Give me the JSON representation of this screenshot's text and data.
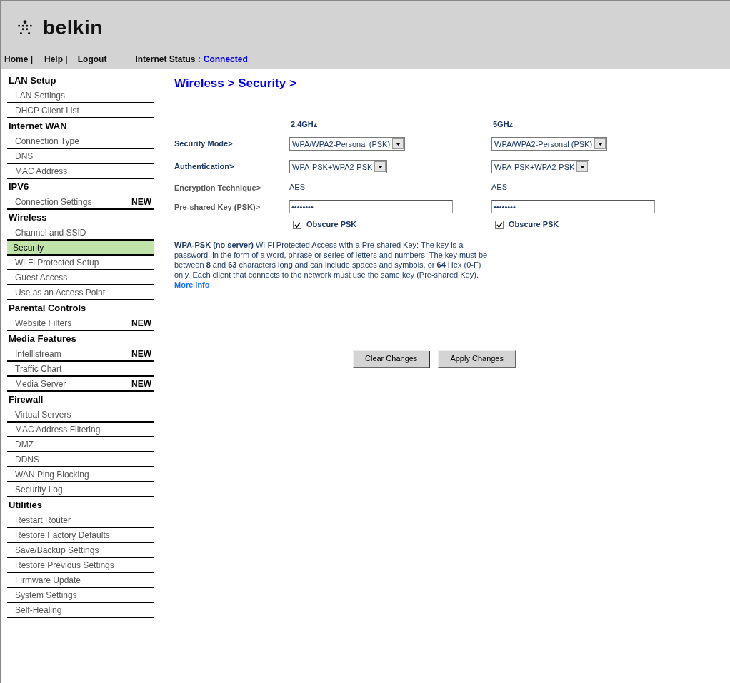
{
  "header": {
    "logo": "belkin",
    "nav": [
      {
        "label": "Home |"
      },
      {
        "label": "Help |"
      },
      {
        "label": "Logout"
      }
    ],
    "internet_status_label": "Internet Status :",
    "internet_status": "Connected"
  },
  "sidebar": [
    {
      "title": "LAN Setup",
      "items": [
        {
          "label": "LAN Settings",
          "selected": false
        },
        {
          "label": "DHCP Client List",
          "selected": false
        }
      ]
    },
    {
      "title": "Internet WAN",
      "items": [
        {
          "label": "Connection Type",
          "selected": false
        },
        {
          "label": "DNS",
          "selected": false
        },
        {
          "label": "MAC Address",
          "selected": false
        }
      ]
    },
    {
      "title": "IPV6",
      "items": [
        {
          "label": "Connection Settings",
          "badge": "NEW",
          "selected": false
        }
      ]
    },
    {
      "title": "Wireless",
      "items": [
        {
          "label": "Channel and SSID",
          "selected": false
        },
        {
          "label": "Security",
          "selected": true
        },
        {
          "label": "Wi-Fi Protected Setup",
          "selected": false
        },
        {
          "label": "Guest Access",
          "selected": false
        },
        {
          "label": "Use as an Access Point",
          "selected": false
        }
      ]
    },
    {
      "title": "Parental Controls",
      "items": [
        {
          "label": "Website Filters",
          "badge": "NEW",
          "selected": false
        }
      ]
    },
    {
      "title": "Media Features",
      "items": [
        {
          "label": "Intellistream",
          "badge": "NEW",
          "selected": false
        },
        {
          "label": "Traffic Chart",
          "selected": false
        },
        {
          "label": "Media Server",
          "badge": "NEW",
          "selected": false
        }
      ]
    },
    {
      "title": "Firewall",
      "items": [
        {
          "label": "Virtual Servers",
          "selected": false
        },
        {
          "label": "MAC Address Filtering",
          "selected": false
        },
        {
          "label": "DMZ",
          "selected": false
        },
        {
          "label": "DDNS",
          "selected": false
        },
        {
          "label": "WAN Ping Blocking",
          "selected": false
        },
        {
          "label": "Security Log",
          "selected": false
        }
      ]
    },
    {
      "title": "Utilities",
      "items": [
        {
          "label": "Restart Router",
          "selected": false
        },
        {
          "label": "Restore Factory Defaults",
          "selected": false
        },
        {
          "label": "Save/Backup Settings",
          "selected": false
        },
        {
          "label": "Restore Previous Settings",
          "selected": false
        },
        {
          "label": "Firmware Update",
          "selected": false
        },
        {
          "label": "System Settings",
          "selected": false
        },
        {
          "label": "Self-Healing",
          "selected": false
        }
      ]
    }
  ],
  "breadcrumb": "Wireless > Security >",
  "bands": [
    {
      "name": "2.4GHz",
      "security_mode": "WPA/WPA2-Personal (PSK)",
      "authentication": "WPA-PSK+WPA2-PSK",
      "encryption": "AES",
      "psk": "••••••••",
      "obscure_label": "Obscure PSK",
      "obscure_checked": true
    },
    {
      "name": "5GHz",
      "security_mode": "WPA/WPA2-Personal (PSK)",
      "authentication": "WPA-PSK+WPA2-PSK",
      "encryption": "AES",
      "psk": "••••••••",
      "obscure_label": "Obscure PSK",
      "obscure_checked": true
    }
  ],
  "labels": {
    "security_mode": "Security Mode>",
    "authentication": "Authentication>",
    "encryption": "Encryption Technique>",
    "psk": "Pre-shared Key (PSK)>"
  },
  "description": "**WPA-PSK (no server)** Wi-Fi Protected Access with a Pre-shared Key: The key is a password, in the form of a word, phrase or series of letters and numbers. The key must be between **8** and **63** characters long and can include spaces and symbols, or **64** Hex (0-F) only. Each client that connects to the network must use the same key (Pre-shared Key).",
  "more_info": "More Info",
  "buttons": [
    {
      "label": "Clear Changes"
    },
    {
      "label": "Apply Changes"
    }
  ]
}
